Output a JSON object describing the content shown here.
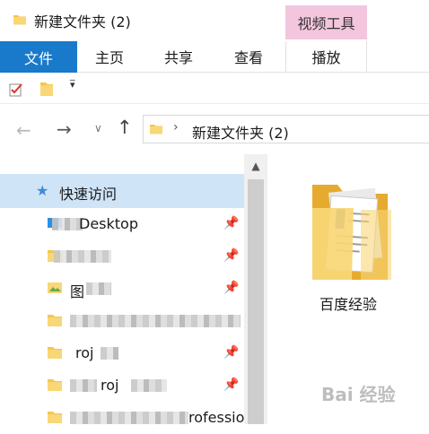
{
  "window": {
    "title": "新建文件夹 (2)"
  },
  "ribbon": {
    "context_header": "视频工具",
    "tabs": {
      "file": "文件",
      "home": "主页",
      "share": "共享",
      "view": "查看",
      "play": "播放"
    }
  },
  "address": {
    "path": "新建文件夹 (2)"
  },
  "nav": {
    "quick_access": "快速访问",
    "items": [
      "Desktop",
      "",
      "图",
      "",
      "roj",
      "roj",
      "rofessional"
    ]
  },
  "content": {
    "items": [
      {
        "name": "百度经验"
      }
    ]
  },
  "watermark": {
    "text": "Bai 经验"
  },
  "colors": {
    "accent": "#1979ca",
    "context_tab": "#f3c6de",
    "folder": "#f5c54e",
    "selection": "#cfe4f7"
  }
}
